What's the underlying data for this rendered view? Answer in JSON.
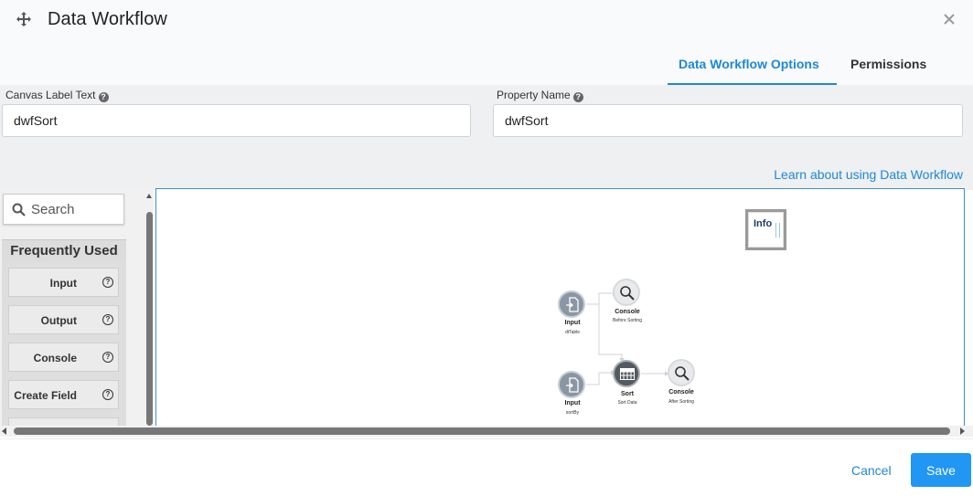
{
  "header": {
    "title": "Data Workflow",
    "tabs": [
      {
        "label": "Data Workflow Options",
        "active": true
      },
      {
        "label": "Permissions",
        "active": false
      }
    ]
  },
  "form": {
    "canvas_label": {
      "label": "Canvas Label Text",
      "value": "dwfSort"
    },
    "property_name": {
      "label": "Property Name",
      "value": "dwfSort"
    },
    "learn_link": "Learn about using Data Workflow"
  },
  "palette": {
    "search_placeholder": "Search",
    "section_title": "Frequently Used",
    "items": [
      {
        "label": "Input"
      },
      {
        "label": "Output"
      },
      {
        "label": "Console"
      },
      {
        "label": "Create Field"
      }
    ]
  },
  "canvas": {
    "info_label": "Info",
    "nodes": [
      {
        "title": "Input",
        "sub": "dtTable",
        "icon": "input-icon"
      },
      {
        "title": "Console",
        "sub": "Before Sorting",
        "icon": "magnifier-icon"
      },
      {
        "title": "Input",
        "sub": "sortBy",
        "icon": "input-icon"
      },
      {
        "title": "Sort",
        "sub": "Sort Data",
        "icon": "table-icon"
      },
      {
        "title": "Console",
        "sub": "After Sorting",
        "icon": "magnifier-icon"
      }
    ]
  },
  "footer": {
    "cancel_label": "Cancel",
    "save_label": "Save"
  },
  "colors": {
    "accent": "#1e88d4",
    "save_button": "#2196f3"
  }
}
